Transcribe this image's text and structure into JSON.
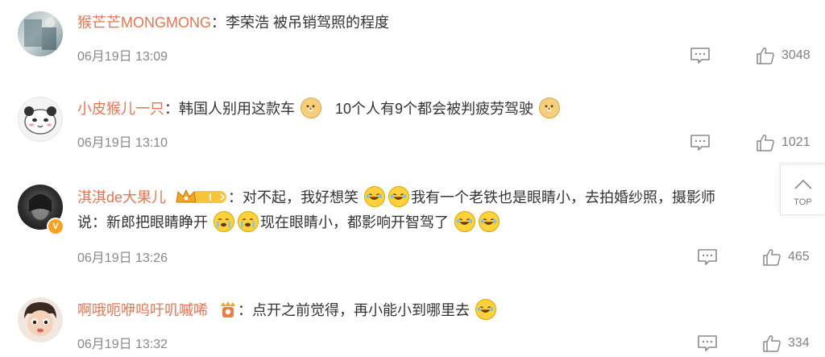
{
  "comments": [
    {
      "username": "猴芒芒MONGMONG",
      "text_parts": [
        "李荣浩 被吊销驾照的程度"
      ],
      "date": "06月19日 13:09",
      "likes": "3048"
    },
    {
      "username": "小皮猴儿一只",
      "text_parts": [
        "韩国人别用这款车",
        "10个人有9个都会被判疲劳驾驶"
      ],
      "date": "06月19日 13:10",
      "likes": "1021"
    },
    {
      "username": "淇淇de大果儿",
      "text_parts": [
        "对不起，我好想笑",
        "我有一个老铁也是眼睛小，去拍婚纱照，摄影师",
        "说：新郎把眼睛睁开",
        "现在眼睛小，都影响开智驾了"
      ],
      "date": "06月19日 13:26",
      "likes": "465",
      "badge_level": "I"
    },
    {
      "username": "啊哦呃咿呜吁叽嘁唏",
      "text_parts": [
        "点开之前觉得，再小能小到哪里去"
      ],
      "date": "06月19日 13:32",
      "likes": "334"
    }
  ],
  "separator": "：",
  "verified_badge": "V",
  "back_to_top": "TOP",
  "colors": {
    "username": "#eb7350",
    "text": "#333333",
    "meta": "#888888",
    "verified": "#f7a120"
  },
  "icons": [
    "comment-icon",
    "thumbs-up-icon",
    "chevron-up-icon",
    "dog-emoji",
    "laugh-cry-emoji",
    "cry-emoji"
  ]
}
